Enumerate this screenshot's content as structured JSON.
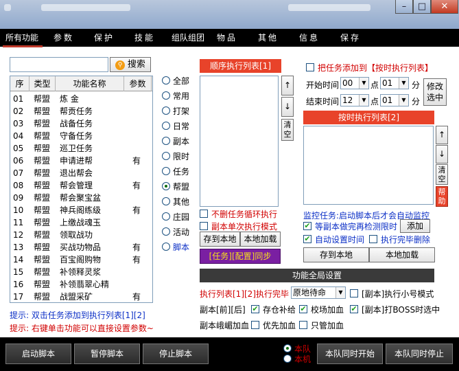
{
  "tabs": [
    "所有功能",
    "参数",
    "保护",
    "技能",
    "组队组团",
    "物品",
    "其他",
    "信息",
    "保存"
  ],
  "search": {
    "value": "",
    "button": "搜索"
  },
  "table": {
    "headers": [
      "序",
      "类型",
      "功能名称",
      "参数"
    ],
    "rows": [
      {
        "no": "01",
        "type": "帮盟",
        "name": "炼  金",
        "param": ""
      },
      {
        "no": "02",
        "type": "帮盟",
        "name": "帮贡任务",
        "param": ""
      },
      {
        "no": "03",
        "type": "帮盟",
        "name": "战备任务",
        "param": ""
      },
      {
        "no": "04",
        "type": "帮盟",
        "name": "守备任务",
        "param": ""
      },
      {
        "no": "05",
        "type": "帮盟",
        "name": "巡卫任务",
        "param": ""
      },
      {
        "no": "06",
        "type": "帮盟",
        "name": "申请进帮",
        "param": "有"
      },
      {
        "no": "07",
        "type": "帮盟",
        "name": "退出帮会",
        "param": ""
      },
      {
        "no": "08",
        "type": "帮盟",
        "name": "帮会管理",
        "param": "有"
      },
      {
        "no": "09",
        "type": "帮盟",
        "name": "帮会聚宝盆",
        "param": ""
      },
      {
        "no": "10",
        "type": "帮盟",
        "name": "神兵阁练级",
        "param": "有"
      },
      {
        "no": "11",
        "type": "帮盟",
        "name": "上缴战魂玉",
        "param": ""
      },
      {
        "no": "12",
        "type": "帮盟",
        "name": "领取战功",
        "param": ""
      },
      {
        "no": "13",
        "type": "帮盟",
        "name": "买战功物品",
        "param": "有"
      },
      {
        "no": "14",
        "type": "帮盟",
        "name": "百宝阁购物",
        "param": "有"
      },
      {
        "no": "15",
        "type": "帮盟",
        "name": "补领释灵浆",
        "param": ""
      },
      {
        "no": "16",
        "type": "帮盟",
        "name": "补领翡翠心精",
        "param": ""
      },
      {
        "no": "17",
        "type": "帮盟",
        "name": "战盟采矿",
        "param": "有"
      }
    ]
  },
  "categories": [
    {
      "label": "全部",
      "selected": false
    },
    {
      "label": "常用",
      "selected": false
    },
    {
      "label": "打架",
      "selected": false
    },
    {
      "label": "日常",
      "selected": false
    },
    {
      "label": "副本",
      "selected": false
    },
    {
      "label": "限时",
      "selected": false
    },
    {
      "label": "任务",
      "selected": false
    },
    {
      "label": "帮盟",
      "selected": true
    },
    {
      "label": "其他",
      "selected": false
    },
    {
      "label": "庄园",
      "selected": false
    },
    {
      "label": "活动",
      "selected": false
    },
    {
      "label": "脚本",
      "selected": false
    }
  ],
  "seq_list": {
    "title": "顺序执行列表[1]",
    "up": "↑",
    "down": "↓",
    "clear": "清空",
    "opt_loop": "不删任务循环执行",
    "opt_single": "副本单次执行模式",
    "save": "存到本地",
    "load": "本地加载",
    "sync": "[任务][配置]同步"
  },
  "timed": {
    "add_to": "把任务添加到【按时执行列表】",
    "start_label": "开始时间",
    "start_hour": "00",
    "start_min": "01",
    "end_label": "结束时间",
    "end_hour": "12",
    "end_min": "01",
    "point": "点",
    "minute": "分",
    "modify": "修改选中",
    "list_title": "按时执行列表[2]",
    "up": "↑",
    "down": "↓",
    "clear": "清空",
    "help": "帮助",
    "monitor": "监控任务:启动脚本后才会自动监控",
    "wait_dungeon": "等副本做完再检测限时",
    "add": "添加",
    "auto_time": "自动设置时间",
    "delete_done": "执行完毕删除",
    "save": "存到本地",
    "load": "本地加载"
  },
  "global": {
    "title": "功能全局设置",
    "exec_done": "执行列表[1][2]执行完毕",
    "exec_option": "原地待命",
    "small_mode": "[副本]执行小号模式",
    "dungeon_fb": "副本[前][后]",
    "warehouse": "存仓补给",
    "field_boost": "校场加血",
    "boss_select": "[副本]打BOSS时选中",
    "emei_boost": "副本峨嵋加血",
    "priority_boost": "优先加血",
    "only_boost": "只管加血"
  },
  "hints": {
    "line1": "提示: 双击任务添加到执行列表[1][2]",
    "line2": "提示: 右键单击功能可以直接设置参数~"
  },
  "bottom": {
    "start": "启动脚本",
    "pause": "暂停脚本",
    "stop": "停止脚本",
    "team": "本队",
    "machine": "本机",
    "team_start": "本队同时开始",
    "team_stop": "本队同时停止"
  },
  "checks": {
    "timed_add": false,
    "loop": false,
    "single": false,
    "wait_dungeon": true,
    "auto_time": true,
    "delete_done": false,
    "small_mode": false,
    "warehouse": true,
    "field_boost": true,
    "boss_select": true,
    "priority": false,
    "only": false
  },
  "colors": {
    "accent_red": "#e8432a",
    "tab_bg": "#000000",
    "hint_blue": "#0b2fc6",
    "hint_red": "#d10000",
    "sync_purple": "#7a1fa2",
    "sync_text": "#f7e11b"
  }
}
